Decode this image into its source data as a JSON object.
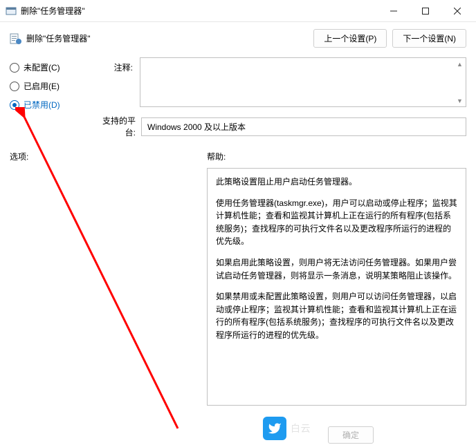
{
  "window": {
    "title": "删除\"任务管理器\""
  },
  "header": {
    "policy_title": "删除\"任务管理器\"",
    "prev_button": "上一个设置(P)",
    "next_button": "下一个设置(N)"
  },
  "radios": {
    "not_configured": "未配置(C)",
    "enabled": "已启用(E)",
    "disabled": "已禁用(D)",
    "selected": "disabled"
  },
  "labels": {
    "comment": "注释:",
    "supported_on": "支持的平台:",
    "options": "选项:",
    "help": "帮助:"
  },
  "supported_on_value": "Windows 2000 及以上版本",
  "help_text": {
    "p1": "此策略设置阻止用户启动任务管理器。",
    "p2": "使用任务管理器(taskmgr.exe)，用户可以启动或停止程序；监视其计算机性能；查看和监视其计算机上正在运行的所有程序(包括系统服务)；查找程序的可执行文件名以及更改程序所运行的进程的优先级。",
    "p3": "如果启用此策略设置，则用户将无法访问任务管理器。如果用户尝试启动任务管理器，则将显示一条消息，说明某策略阻止该操作。",
    "p4": "如果禁用或未配置此策略设置，则用户可以访问任务管理器，以启动或停止程序；监视其计算机性能；查看和监视其计算机上正在运行的所有程序(包括系统服务)；查找程序的可执行文件名以及更改程序所运行的进程的优先级。"
  },
  "footer": {
    "ok": "确定"
  },
  "watermark": {
    "brand": "白云"
  }
}
